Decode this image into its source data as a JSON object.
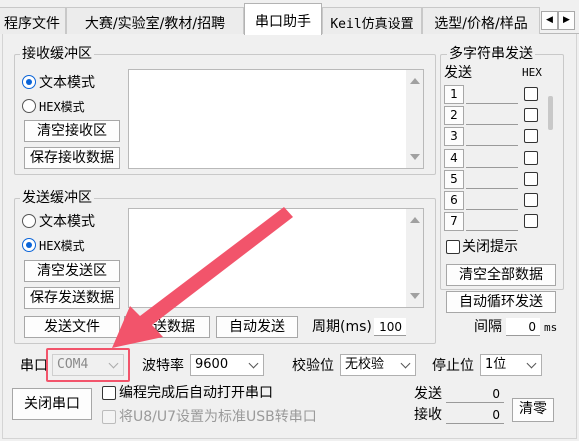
{
  "tabs": [
    {
      "label": "程序文件"
    },
    {
      "label": "大赛/实验室/教材/招聘"
    },
    {
      "label": "串口助手"
    },
    {
      "label": "Keil仿真设置"
    },
    {
      "label": "选型/价格/样品"
    }
  ],
  "receive": {
    "title": "接收缓冲区",
    "text_mode": "文本模式",
    "hex_mode": "HEX模式",
    "selected": "text",
    "clear_btn": "清空接收区",
    "save_btn": "保存接收数据"
  },
  "send": {
    "title": "发送缓冲区",
    "text_mode": "文本模式",
    "hex_mode": "HEX模式",
    "selected": "hex",
    "clear_btn": "清空发送区",
    "save_btn": "保存发送数据",
    "send_file_btn": "发送文件",
    "send_data_btn": "发送数据",
    "auto_send_btn": "自动发送",
    "period_label": "周期(ms)",
    "period_value": "100"
  },
  "multi": {
    "title": "多字符串发送",
    "col_send": "发送",
    "col_hex": "HEX",
    "rows": [
      "1",
      "2",
      "3",
      "4",
      "5",
      "6",
      "7"
    ],
    "close_hint": "关闭提示",
    "clear_all_btn": "清空全部数据",
    "auto_loop_btn": "自动循环发送",
    "interval_label": "间隔",
    "interval_value": "0",
    "interval_unit": "ms"
  },
  "settings": {
    "port_label": "串口",
    "port_value": "COM4",
    "baud_label": "波特率",
    "baud_value": "9600",
    "parity_label": "校验位",
    "parity_value": "无校验",
    "stop_label": "停止位",
    "stop_value": "1位",
    "close_port_btn": "关闭串口",
    "auto_open_label": "编程完成后自动打开串口",
    "usb_label": "将U8/U7设置为标准USB转串口",
    "sent_label": "发送",
    "sent_value": "0",
    "recv_label": "接收",
    "recv_value": "0",
    "clear_btn": "清零"
  },
  "colors": {
    "arrow": "#f2546b",
    "highlight": "#f2546b",
    "radio_on": "#0a64d8"
  }
}
